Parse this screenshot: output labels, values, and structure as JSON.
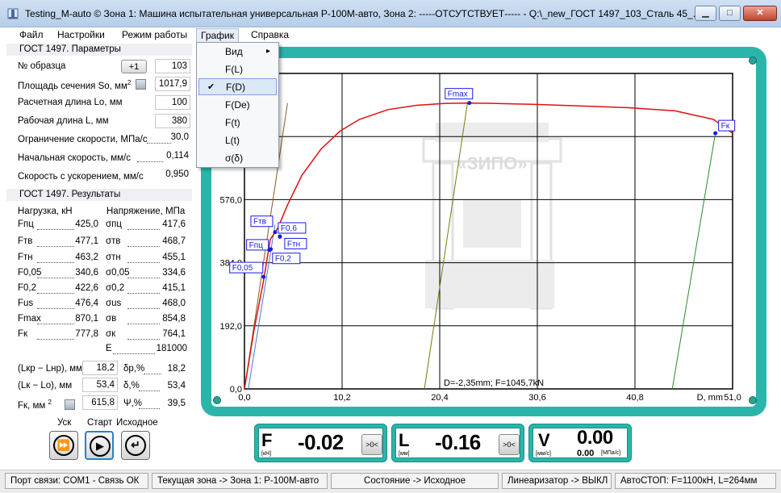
{
  "window": {
    "title": "Testing_M-auto ©  Зона 1: Машина испытательная универсальная Р-100М-авто, Зона 2: -----ОТСУТСТВУЕТ----- - Q:\\_new_ГОСТ 1497_103_Сталь 45_...",
    "min_btn": "▁",
    "max_btn": "□",
    "close_btn": "✕"
  },
  "menu": [
    "Файл",
    "Настройки",
    "Режим работы",
    "График",
    "Справка"
  ],
  "dropdown": {
    "items": [
      "Вид",
      "F(L)",
      "F(D)",
      "F(De)",
      "F(t)",
      "L(t)",
      "σ(δ)"
    ],
    "selected": "F(D)",
    "submenu_arrow": "▸",
    "check": "✔"
  },
  "params": {
    "header": "ГОСТ 1497. Параметры",
    "sample_no_label": "№ образца",
    "plus_btn": "+1",
    "sample_no": "103",
    "area_label": "Площадь сечения So, мм",
    "area_sup": "2",
    "area": "1017,9",
    "calc_len_label": "Расчетная длина Lo, мм",
    "calc_len": "100",
    "work_len_label": "Рабочая длина L, мм",
    "work_len": "380",
    "speed_limit_label": "Ограничение скорости, МПа/с",
    "speed_limit": "30,0",
    "init_speed_label": "Начальная скорость, мм/с",
    "init_speed": "0,114",
    "accel_speed_label": "Скорость с ускорением, мм/с",
    "accel_speed": "0,950"
  },
  "results": {
    "header": "ГОСТ 1497. Результаты",
    "load_col": "Нагрузка, кН",
    "stress_col": "Напряжение, МПа",
    "rows": [
      {
        "f": "Fпц",
        "fv": "425,0",
        "s": "σпц",
        "sv": "417,6"
      },
      {
        "f": "Fтв",
        "fv": "477,1",
        "s": "σтв",
        "sv": "468,7"
      },
      {
        "f": "Fтн",
        "fv": "463,2",
        "s": "σтн",
        "sv": "455,1"
      },
      {
        "f": "F0,05",
        "fv": "340,6",
        "s": "σ0,05",
        "sv": "334,6"
      },
      {
        "f": "F0,2",
        "fv": "422,6",
        "s": "σ0,2",
        "sv": "415,1"
      },
      {
        "f": "Fus",
        "fv": "476,4",
        "s": "σus",
        "sv": "468,0"
      },
      {
        "f": "Fmax",
        "fv": "870,1",
        "s": "σв",
        "sv": "854,8"
      },
      {
        "f": "Fк",
        "fv": "777,8",
        "s": "σк",
        "sv": "764,1"
      }
    ],
    "e_label": "E",
    "e_val": "181000",
    "lkp_label": "(Lкр − Lнр), мм",
    "lkp_val": "18,2",
    "dp_label": "δр,%",
    "dp_val": "18,2",
    "lk_label": "(Lк − Lo), мм",
    "lk_val": "53,4",
    "d_label": "δ,%",
    "d_val": "53,4",
    "fk_label": "Fк, мм",
    "fk_sup": "2",
    "fk_val": "615,8",
    "psi_label": "Ψ,%",
    "psi_val": "39,5"
  },
  "controls": {
    "usk_label": "Уск",
    "start_label": "Старт",
    "home_label": "Исходное",
    "ff_icon": "⏩",
    "play_icon": "▶",
    "return_icon": "↵"
  },
  "chart": {
    "info": "D=-2,35mm; F=1045,7kN",
    "x_title": "D, mm",
    "watermark": "«ЗИПО»",
    "x_ticks": [
      "0,0",
      "10,2",
      "20,4",
      "30,6",
      "40,8",
      "51,0"
    ],
    "y_ticks": [
      "0,0",
      "192,0",
      "384,0",
      "576,0"
    ],
    "markers": [
      "Fmax",
      "Fк",
      "Fтв",
      "F0,6",
      "Fпц",
      "Fтн",
      "F0,2",
      "F0,05"
    ]
  },
  "chart_data": {
    "type": "line",
    "xlabel": "D, mm",
    "xlim": [
      0,
      51.0
    ],
    "ylim": [
      0,
      960
    ],
    "x_ticks": [
      0,
      10.2,
      20.4,
      30.6,
      40.8,
      51.0
    ],
    "y_ticks": [
      0,
      192,
      384,
      576
    ],
    "series": [
      {
        "color": "#e01010",
        "x": [
          0,
          1.0,
          2.0,
          2.7,
          3.5,
          4.5,
          6,
          8,
          10,
          12,
          15,
          18,
          21,
          23.5,
          26,
          30,
          35,
          40,
          45,
          49,
          51.0
        ],
        "y": [
          0,
          180,
          330,
          455,
          490,
          560,
          650,
          730,
          785,
          820,
          850,
          863,
          869,
          870,
          869,
          866,
          861,
          856,
          846,
          820,
          778
        ]
      }
    ],
    "points": [
      {
        "name": "Fmax",
        "x": 23.5,
        "y": 870
      },
      {
        "name": "Fк",
        "x": 49.2,
        "y": 778
      },
      {
        "name": "Fтв",
        "x": 3.2,
        "y": 477
      },
      {
        "name": "F0,6",
        "x": 3.7,
        "y": 464
      },
      {
        "name": "Fпц",
        "x": 2.75,
        "y": 425
      },
      {
        "name": "Fтн",
        "x": 3.7,
        "y": 463
      },
      {
        "name": "F0,2",
        "x": 2.6,
        "y": 423
      },
      {
        "name": "F0,05",
        "x": 2.0,
        "y": 341
      }
    ],
    "lines": [
      {
        "color": "#8a5a2a",
        "x1": 0,
        "y1": 0,
        "x2": 4.5,
        "y2": 870
      },
      {
        "color": "#3a7fd8",
        "x1": 0.4,
        "y1": 0,
        "x2": 3.2,
        "y2": 500
      },
      {
        "color": "#7a7a10",
        "x1": 18.8,
        "y1": 0,
        "x2": 23.3,
        "y2": 870
      },
      {
        "color": "#2a8a2a",
        "x1": 44.7,
        "y1": 0,
        "x2": 49.2,
        "y2": 778
      }
    ]
  },
  "meters": {
    "f_letter": "F",
    "f_unit": "[кН]",
    "f_value": "-0.02",
    "f_zero": ">0<",
    "l_letter": "L",
    "l_unit": "[мм]",
    "l_value": "-0.16",
    "l_zero": ">0<",
    "v_letter": "V",
    "v_unit": "[мм/с]",
    "v_value": "0.00",
    "v_sub_value": "0.00",
    "v_sub_unit": "[МПа/с]"
  },
  "status": {
    "port": "Порт связи: COM1 - Связь ОК",
    "zone": "Текущая зона -> Зона 1: Р-100М-авто",
    "state": "Состояние -> Исходное",
    "linearizer": "Линеаризатор -> ВЫКЛ",
    "autostop": "АвтоСТОП: F=1100кН, L=264мм"
  },
  "colors": {
    "frame": "#2bb5aa",
    "curve": "#e01010",
    "marker": "#1a1ae0",
    "marker_label": "#1a1ae0"
  }
}
